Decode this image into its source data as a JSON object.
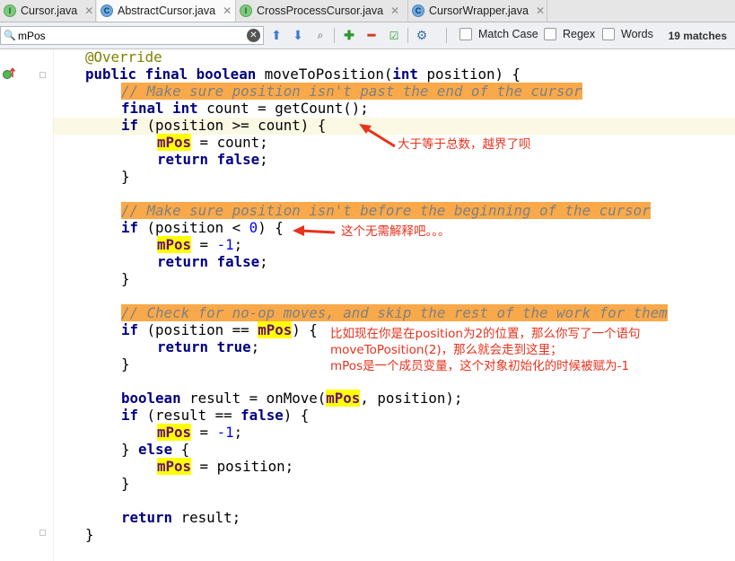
{
  "tabs": [
    {
      "label": "Cursor.java",
      "icon": "I",
      "active": false
    },
    {
      "label": "AbstractCursor.java",
      "icon": "C",
      "active": true
    },
    {
      "label": "CrossProcessCursor.java",
      "icon": "I",
      "active": false
    },
    {
      "label": "CursorWrapper.java",
      "icon": "C",
      "active": false
    }
  ],
  "find": {
    "query": "mPos",
    "match_case_label": "Match Case",
    "regex_label": "Regex",
    "words_label": "Words",
    "matches": "19 matches",
    "icons": [
      "search-icon",
      "clear-icon",
      "up-arrow-icon",
      "down-arrow-icon",
      "find-all-icon",
      "add-occurrence-icon",
      "remove-occurrence-icon",
      "select-all-occurrences-icon",
      "settings-icon"
    ]
  },
  "code": {
    "l1": "@Override",
    "l2_a": "public final boolean",
    "l2_b": " moveToPosition(",
    "l2_c": "int",
    "l2_d": " position) {",
    "c1": "// Make sure position isn't past the end of the cursor",
    "l4_a": "final int",
    "l4_b": " count = getCount();",
    "l5_a": "if",
    "l5_b": " (position >= count) {",
    "field": "mPos",
    "l6_b": " = count;",
    "ret": "return",
    "false": "false",
    "true": "true",
    "semi": ";",
    "close": "}",
    "c2": "// Make sure position isn't before the beginning of the cursor",
    "l10_b": " (position < ",
    "zero": "0",
    "l10_c": ") {",
    "l11_b": " = ",
    "neg1": "-1",
    "c3": "// Check for no-op moves, and skip the rest of the work for them",
    "l15_b": " (position == ",
    "l15_c": ") {",
    "l18_a": "boolean",
    "l18_b": " result = onMove(",
    "l18_c": ", position);",
    "l19_b": " (result == ",
    "l19_c": ") {",
    "l21_a": "} ",
    "l21_b": "else",
    "l21_c": " {",
    "l22_b": " = position;",
    "l25_b": " result;"
  },
  "notes": {
    "n1": "大于等于总数，越界了呗",
    "n2": "这个无需解释吧。。。",
    "n3_1": "比如现在你是在position为2的位置，那么你写了一个语句",
    "n3_2": "moveToPosition(2)，那么就会走到这里；",
    "n3_3": "mPos是一个成员变量，这个对象初始化的时候被赋为-1"
  },
  "colors": {
    "keyword": "#000080",
    "field": "#660e7a",
    "comment_bg": "#f9a94a",
    "highlight": "#ffff00",
    "annotation_text": "#e8321c"
  }
}
